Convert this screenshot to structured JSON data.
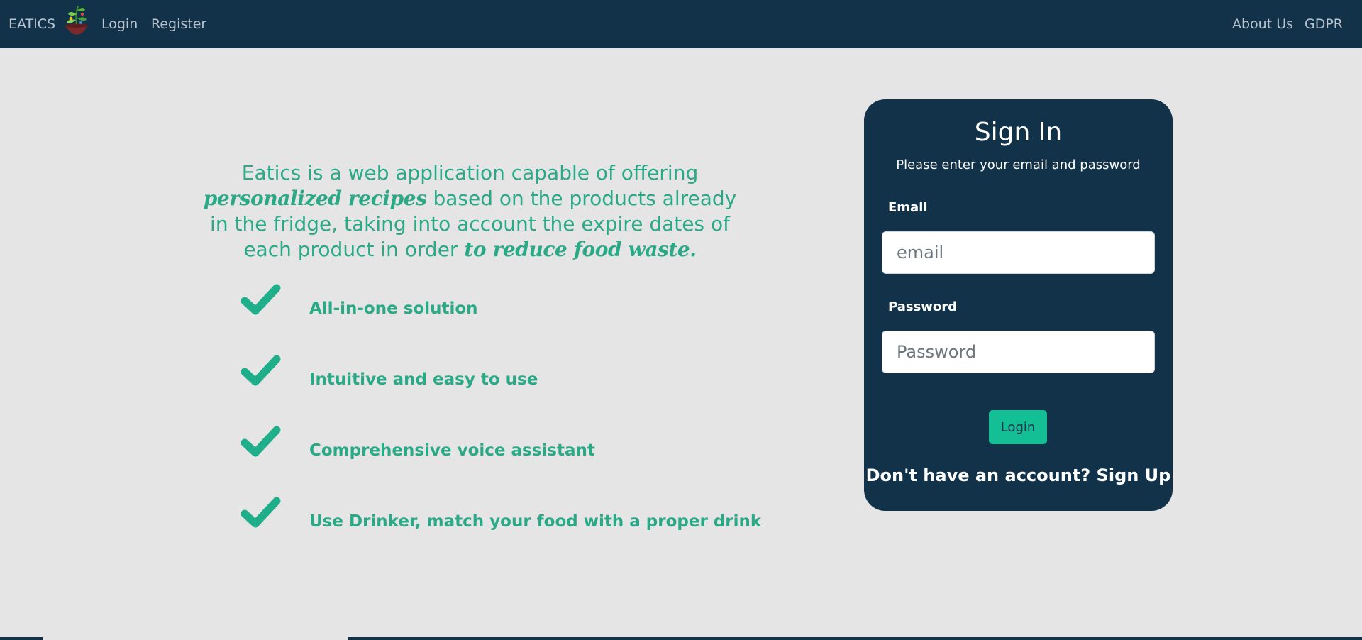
{
  "navbar": {
    "brand": "EATICS",
    "links_left": [
      "Login",
      "Register"
    ],
    "links_right": [
      "About Us",
      "GDPR"
    ]
  },
  "pitch": {
    "part1": "Eatics is a web application capable of offering ",
    "highlight1": "personalized recipes",
    "part2": " based on the products already in the fridge, taking into account the expire dates of each product in order ",
    "highlight2": "to reduce food waste."
  },
  "features": [
    {
      "label": "All-in-one solution",
      "icon": "check-icon"
    },
    {
      "label": "Intuitive and easy to use",
      "icon": "check-icon"
    },
    {
      "label": "Comprehensive voice assistant",
      "icon": "check-icon"
    },
    {
      "label": "Use Drinker, match your food with a proper drink",
      "icon": "check-icon"
    }
  ],
  "signin": {
    "title": "Sign In",
    "subtitle": "Please enter your email and password",
    "email_label": "Email",
    "email_placeholder": "email",
    "email_value": "",
    "password_label": "Password",
    "password_placeholder": "Password",
    "password_value": "",
    "login_button": "Login",
    "signup_text": "Don't have an account? Sign Up"
  },
  "colors": {
    "navbar": "#12324a",
    "background": "#e5e5e5",
    "accent_green": "#2aa987",
    "button_green": "#14bf96",
    "card": "#12324a"
  }
}
